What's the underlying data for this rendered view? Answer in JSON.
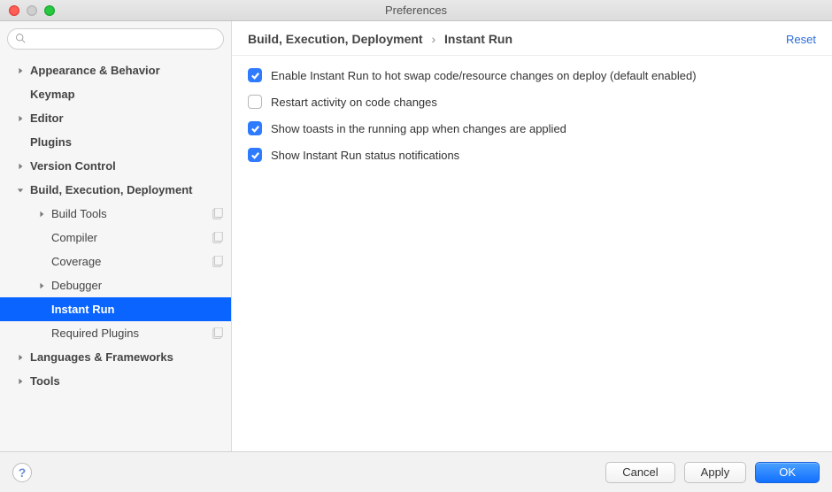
{
  "window": {
    "title": "Preferences"
  },
  "search": {
    "placeholder": ""
  },
  "sidebar": {
    "items": [
      {
        "label": "Appearance & Behavior",
        "level": 1,
        "expandable": true,
        "expanded": false,
        "badge": false
      },
      {
        "label": "Keymap",
        "level": 1,
        "expandable": false,
        "badge": false
      },
      {
        "label": "Editor",
        "level": 1,
        "expandable": true,
        "expanded": false,
        "badge": false
      },
      {
        "label": "Plugins",
        "level": 1,
        "expandable": false,
        "badge": false
      },
      {
        "label": "Version Control",
        "level": 1,
        "expandable": true,
        "expanded": false,
        "badge": false
      },
      {
        "label": "Build, Execution, Deployment",
        "level": 1,
        "expandable": true,
        "expanded": true,
        "badge": false
      },
      {
        "label": "Build Tools",
        "level": 2,
        "expandable": true,
        "expanded": false,
        "badge": true
      },
      {
        "label": "Compiler",
        "level": 2,
        "expandable": false,
        "badge": true
      },
      {
        "label": "Coverage",
        "level": 2,
        "expandable": false,
        "badge": true
      },
      {
        "label": "Debugger",
        "level": 2,
        "expandable": true,
        "expanded": false,
        "badge": false
      },
      {
        "label": "Instant Run",
        "level": 2,
        "expandable": false,
        "badge": false,
        "selected": true
      },
      {
        "label": "Required Plugins",
        "level": 2,
        "expandable": false,
        "badge": true
      },
      {
        "label": "Languages & Frameworks",
        "level": 1,
        "expandable": true,
        "expanded": false,
        "badge": false
      },
      {
        "label": "Tools",
        "level": 1,
        "expandable": true,
        "expanded": false,
        "badge": false
      }
    ]
  },
  "breadcrumb": {
    "parent": "Build, Execution, Deployment",
    "current": "Instant Run"
  },
  "reset_label": "Reset",
  "options": [
    {
      "label": "Enable Instant Run to hot swap code/resource changes on deploy (default enabled)",
      "checked": true
    },
    {
      "label": "Restart activity on code changes",
      "checked": false
    },
    {
      "label": "Show toasts in the running app when changes are applied",
      "checked": true
    },
    {
      "label": "Show Instant Run status notifications",
      "checked": true
    }
  ],
  "footer": {
    "help": "?",
    "cancel": "Cancel",
    "apply": "Apply",
    "ok": "OK"
  }
}
